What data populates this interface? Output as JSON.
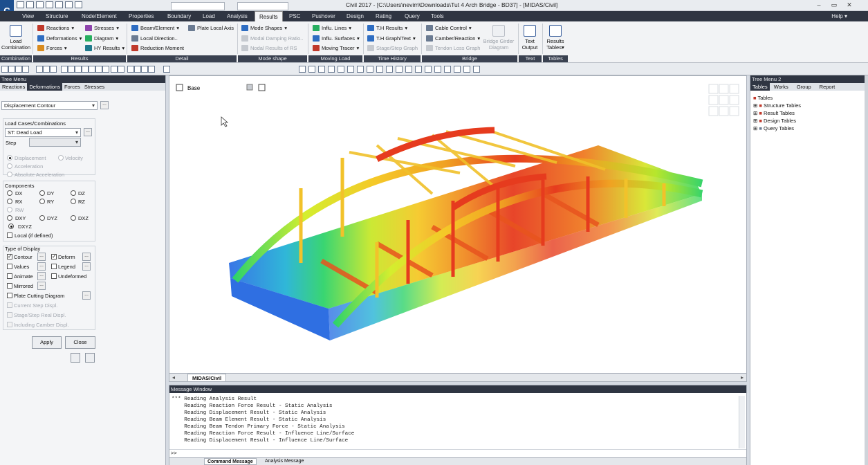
{
  "app": {
    "icon_letter": "C",
    "title": "Civil 2017 - [C:\\Users\\nevim\\Downloads\\Tut 4 Arch Bridge - BD37] - [MIDAS/Civil]",
    "help": "Help"
  },
  "menu": [
    "View",
    "Structure",
    "Node/Element",
    "Properties",
    "Boundary",
    "Load",
    "Analysis",
    "Results",
    "PSC",
    "Pushover",
    "Design",
    "Rating",
    "Query",
    "Tools"
  ],
  "ribbon": {
    "combination": {
      "big": [
        "Load",
        "Combination"
      ],
      "group": "Combination"
    },
    "results": {
      "items": [
        "Reactions",
        "Deformations",
        "Forces",
        "Stresses",
        "Diagram",
        "HY Results"
      ],
      "group": "Results"
    },
    "detail": {
      "items": [
        "Beam/Element",
        "Local Direction..",
        "Reduction Moment",
        "Plate Local Axis"
      ],
      "group": "Detail"
    },
    "mode": {
      "items": [
        "Mode Shapes",
        "Modal Damping Ratio..",
        "Nodal Results of RS"
      ],
      "group": "Mode shape"
    },
    "moving": {
      "items": [
        "Influ. Lines",
        "Influ. Surfaces",
        "Moving Tracer"
      ],
      "group": "Moving Load"
    },
    "time": {
      "items": [
        "T.H Results",
        "T.H Graph/Text",
        "Stage/Step Graph"
      ],
      "group": "Time History"
    },
    "bridge": {
      "items": [
        "Cable Control",
        "Camber/Reaction",
        "Tendon Loss Graph"
      ],
      "big": [
        "Bridge Girder",
        "Diagram"
      ],
      "group": "Bridge"
    },
    "text": {
      "big": [
        "Text",
        "Output"
      ],
      "group": "Text"
    },
    "tables": {
      "big": [
        "Results",
        "Tables"
      ],
      "group": "Tables"
    }
  },
  "left_panel": {
    "header": "Tree Menu",
    "tabs": [
      "Reactions",
      "Deformations",
      "Forces",
      "Stresses"
    ],
    "mode_select": "Displacement Contour",
    "load_title": "Load Cases/Combinations",
    "load_select": "ST: Dead Load",
    "step_label": "Step",
    "type_options": [
      "Displacement",
      "Velocity",
      "Acceleration",
      "Absolute Acceleration"
    ],
    "components_title": "Components",
    "components": [
      "DX",
      "DY",
      "DZ",
      "RX",
      "RY",
      "RZ",
      "RW",
      "DXY",
      "DYZ",
      "DXZ",
      "DXYZ"
    ],
    "local_label": "Local (if defined)",
    "display_title": "Type of Display",
    "display": [
      "Contour",
      "Deform",
      "Values",
      "Legend",
      "Animate",
      "Undeformed",
      "Mirrored"
    ],
    "plate_label": "Plate Cutting Diagram",
    "dim_options": [
      "Current Step Displ.",
      "Stage/Step Real Displ.",
      "Including Camber Displ."
    ],
    "apply": "Apply",
    "close": "Close"
  },
  "viewport": {
    "base": "Base",
    "tab": "MIDAS/Civil"
  },
  "message": {
    "header": "Message Window",
    "lines": [
      "*** Reading Analysis Result",
      "    Reading Reaction Force Result - Static Analysis",
      "    Reading Displacement Result - Static Analysis",
      "    Reading Beam Element Result - Static Analysis",
      "    Reading Beam Tendon Primary Force - Static Analysis",
      "    Reading Reaction Force Result - Influence Line/Surface",
      "    Reading Displacement Result - Influence Line/Surface"
    ],
    "prompt": ">>",
    "tabs": [
      "Command Message",
      "Analysis Message"
    ]
  },
  "right_panel": {
    "header": "Tree Menu 2",
    "tabs": [
      "Tables",
      "Works",
      "Group",
      "Report"
    ],
    "root": "Tables",
    "items": [
      "Structure Tables",
      "Result Tables",
      "Design Tables",
      "Query Tables"
    ]
  },
  "colors": {
    "dark": "#2f3542",
    "accent": "#1d4f8e",
    "red": "#e02a1c",
    "blue": "#2a6fe0"
  }
}
